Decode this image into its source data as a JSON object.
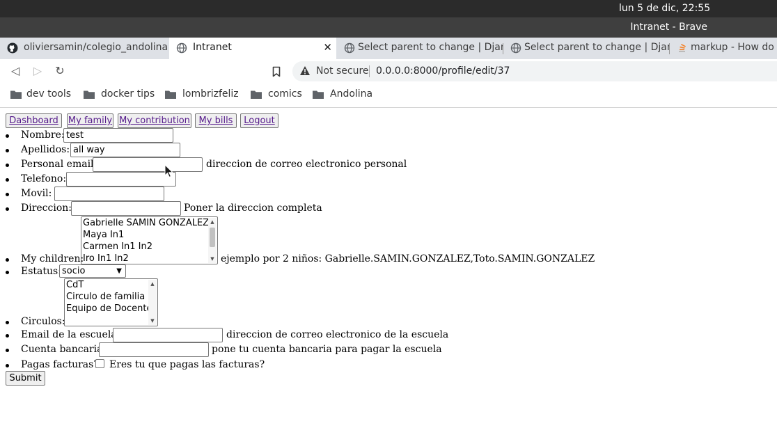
{
  "system": {
    "clock": "lun  5 de dic, 22:55"
  },
  "window": {
    "title": "Intranet - Brave"
  },
  "tabs": [
    {
      "label": "oliviersamin/colegio_andolina",
      "icon": "github-icon"
    },
    {
      "label": "Intranet",
      "icon": "globe-icon",
      "active": true,
      "close": "✕"
    },
    {
      "label": "Select parent to change | Django",
      "icon": "globe-icon"
    },
    {
      "label": "Select parent to change | Django",
      "icon": "globe-icon"
    },
    {
      "label": "markup - How do you",
      "icon": "stackoverflow-icon"
    }
  ],
  "navbar": {
    "security_label": "Not secure",
    "url": "0.0.0.0:8000/profile/edit/37"
  },
  "bookmarks": [
    "dev tools",
    "docker tips",
    "lombrizfeliz",
    "comics",
    "Andolina"
  ],
  "menu": [
    "Dashboard",
    "My family",
    "My contribution",
    "My bills",
    "Logout"
  ],
  "form": {
    "nombre": {
      "label": "Nombre:",
      "value": "test"
    },
    "apellidos": {
      "label": "Apellidos:",
      "value": "all way"
    },
    "personal_email": {
      "label": "Personal email:",
      "value": "",
      "help": "direccion de correo electronico personal"
    },
    "telefono": {
      "label": "Telefono:",
      "value": ""
    },
    "movil": {
      "label": "Movil:",
      "value": ""
    },
    "direccion": {
      "label": "Direccion:",
      "value": "",
      "help": "Poner la direccion completa"
    },
    "children": {
      "label": "My children:",
      "options": [
        "Gabrielle SAMIN GONZALEZ",
        "Maya In1",
        "Carmen In1 In2",
        "Iro In1 In2"
      ],
      "help": "ejemplo por 2 niños: Gabrielle.SAMIN.GONZALEZ,Toto.SAMIN.GONZALEZ"
    },
    "estatus": {
      "label": "Estatus:",
      "selected": "socio"
    },
    "circulos": {
      "label": "Circulos:",
      "options": [
        "CdT",
        "Circulo de familia",
        "Equipo de Docente"
      ]
    },
    "email_escuela": {
      "label": "Email de la escuela:",
      "value": "",
      "help": "direccion de correo electronico de la escuela"
    },
    "cuenta_bancaria": {
      "label": "Cuenta bancaria:",
      "value": "",
      "help": "pone tu cuenta bancaria para pagar la escuela"
    },
    "pagas_facturas": {
      "label": "Pagas facturas?",
      "checked": false,
      "help": "Eres tu que pagas las facturas?"
    },
    "submit": "Submit"
  },
  "colors": {
    "link": "#551a8b",
    "tabstrip": "#dee1e6",
    "titlebar": "#3f3f3f",
    "topbar": "#2b2b2b"
  }
}
